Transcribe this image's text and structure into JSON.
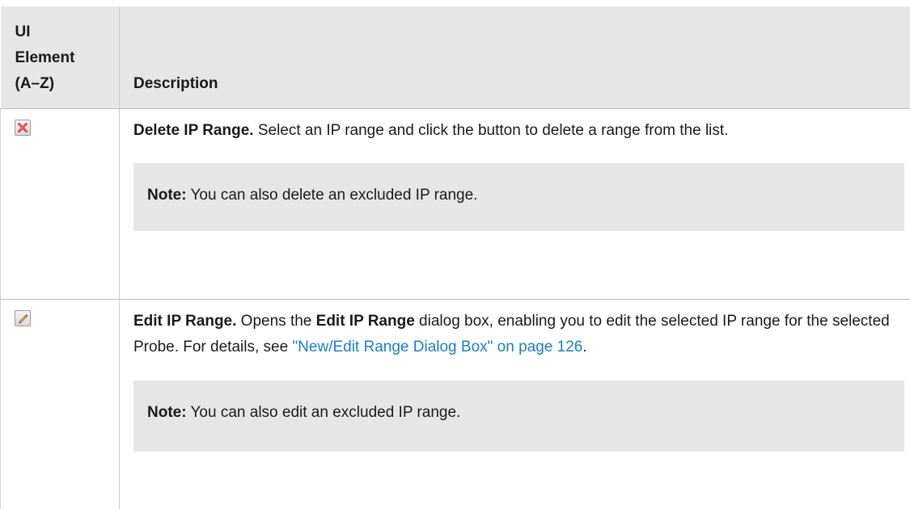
{
  "table": {
    "header": {
      "col1": [
        "UI",
        "Element",
        "(A–Z)"
      ],
      "col2": "Description"
    },
    "rows": [
      {
        "icon": "delete-x-icon",
        "title": "Delete IP Range.",
        "text": " Select an IP range and click the button to delete a range from the list.",
        "note_label": "Note:",
        "note_text": " You can also delete an excluded IP range."
      },
      {
        "icon": "pencil-edit-icon",
        "title": "Edit IP Range.",
        "text_before": " Opens the ",
        "bold_dialog": "Edit IP Range",
        "text_after": " dialog box, enabling you to edit the selected IP range for the selected Probe. For details, see ",
        "link_text": "\"New/Edit Range Dialog Box\" on page 126",
        "text_end": ".",
        "note_label": "Note:",
        "note_text": " You can also edit an excluded IP range."
      }
    ]
  },
  "colors": {
    "header_bg": "#e6e6e6",
    "note_bg": "#e6e6e6",
    "link": "#1c7ec4",
    "delete_icon_red": "#d8342a"
  }
}
